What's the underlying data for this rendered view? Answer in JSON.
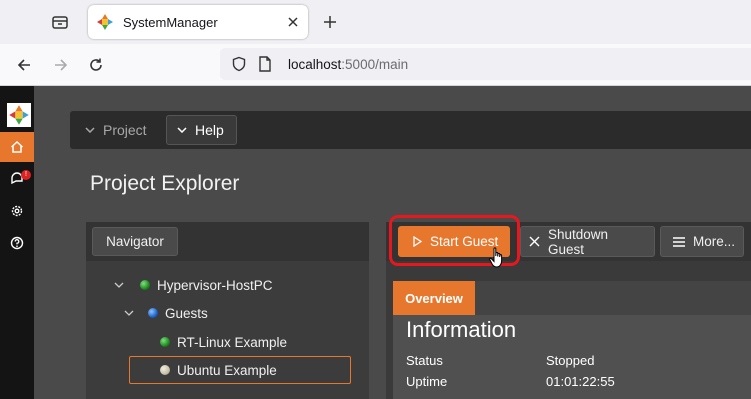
{
  "browser": {
    "tab_title": "SystemManager",
    "url_host": "localhost",
    "url_path": ":5000/main"
  },
  "menubar": {
    "project_label": "Project",
    "help_label": "Help"
  },
  "page": {
    "title": "Project Explorer"
  },
  "sidebar": {
    "notifications_badge": "!"
  },
  "navigator": {
    "button_label": "Navigator",
    "tree": [
      {
        "label": "Hypervisor-HostPC",
        "status": "green"
      },
      {
        "label": "Guests",
        "status": "blue"
      },
      {
        "label": "RT-Linux Example",
        "status": "green"
      },
      {
        "label": "Ubuntu Example",
        "status": "gray",
        "selected": true
      }
    ]
  },
  "toolbar": {
    "start_label": "Start Guest",
    "shutdown_label": "Shutdown Guest",
    "more_label": "More..."
  },
  "panel": {
    "tab_label": "Overview",
    "section_title": "Information",
    "rows": [
      {
        "key": "Status",
        "value": "Stopped"
      },
      {
        "key": "Uptime",
        "value": "01:01:22:55"
      }
    ]
  },
  "colors": {
    "accent": "#e8772e",
    "highlight": "#e8161d"
  }
}
